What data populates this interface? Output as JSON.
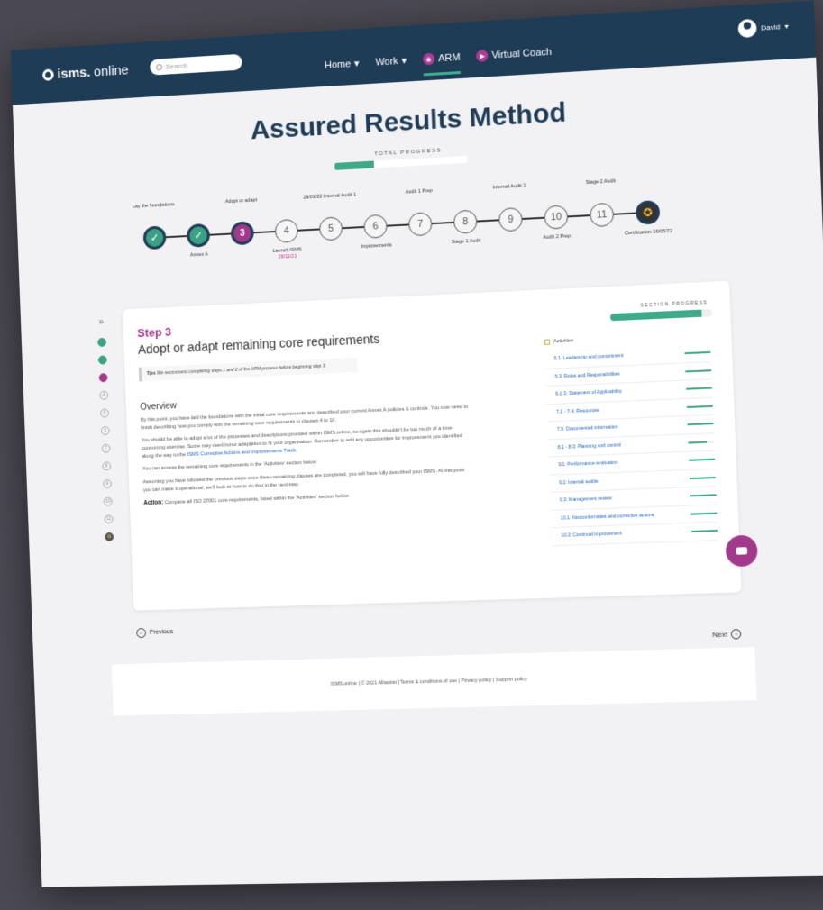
{
  "header": {
    "logo_bold": "isms.",
    "logo_thin": "online",
    "search_placeholder": "Search",
    "nav": [
      {
        "label": "Home",
        "caret": "▾"
      },
      {
        "label": "Work",
        "caret": "▾"
      },
      {
        "label": "ARM",
        "icon": "arm-icon"
      },
      {
        "label": "Virtual Coach",
        "icon": "coach-icon"
      }
    ],
    "user_name": "David",
    "user_caret": "▾"
  },
  "title": "Assured Results Method",
  "total_progress": {
    "label": "TOTAL PROGRESS",
    "value": 0.3
  },
  "stepper": {
    "steps": [
      {
        "num": "✓",
        "state": "done",
        "label_top": "Lay the foundations",
        "label_bottom": ""
      },
      {
        "num": "✓",
        "state": "done",
        "label_top": "",
        "label_bottom": "Annex A"
      },
      {
        "num": "3",
        "state": "current",
        "label_top": "Adopt or adapt",
        "label_bottom": ""
      },
      {
        "num": "4",
        "state": "todo",
        "label_top": "",
        "label_bottom": "Launch ISMS",
        "sub": "29/11/21"
      },
      {
        "num": "5",
        "state": "todo",
        "label_top": "29/01/22 Internal Audit 1",
        "label_bottom": ""
      },
      {
        "num": "6",
        "state": "todo",
        "label_top": "",
        "label_bottom": "Improvements"
      },
      {
        "num": "7",
        "state": "todo",
        "label_top": "Audit 1 Prep",
        "label_bottom": ""
      },
      {
        "num": "8",
        "state": "todo",
        "label_top": "",
        "label_bottom": "Stage 1 Audit"
      },
      {
        "num": "9",
        "state": "todo",
        "label_top": "Internal Audit 2",
        "label_bottom": ""
      },
      {
        "num": "10",
        "state": "todo",
        "label_top": "",
        "label_bottom": "Audit 2 Prep"
      },
      {
        "num": "11",
        "state": "todo",
        "label_top": "Stage 2 Audit",
        "label_bottom": ""
      },
      {
        "num": "✪",
        "state": "cert",
        "label_top": "",
        "label_bottom": "Certification 16/05/22"
      }
    ]
  },
  "sidebar": {
    "collapse": "»",
    "items": [
      {
        "state": "done",
        "glyph": ""
      },
      {
        "state": "done",
        "glyph": ""
      },
      {
        "state": "cur",
        "glyph": ""
      },
      {
        "state": "todo",
        "glyph": "4"
      },
      {
        "state": "todo",
        "glyph": "5"
      },
      {
        "state": "todo",
        "glyph": "6"
      },
      {
        "state": "todo",
        "glyph": "7"
      },
      {
        "state": "todo",
        "glyph": "8"
      },
      {
        "state": "todo",
        "glyph": "9"
      },
      {
        "state": "todo",
        "glyph": "10"
      },
      {
        "state": "todo",
        "glyph": "11"
      },
      {
        "state": "cert",
        "glyph": "✪"
      }
    ]
  },
  "step": {
    "kicker": "Step 3",
    "title": "Adopt or adapt remaining core requirements",
    "tip_label": "Tips",
    "tip_text": "We recommend completing steps 1 and 2 of the ARM process before beginning step 3.",
    "overview_heading": "Overview",
    "p1": "By this point, you have laid the foundations with the initial core requirements and described your current Annex A policies & controls. You now need to finish describing how you comply with the remaining core requirements in clauses 4 to 10.",
    "p2_pre": "You should be able to adopt a lot of the processes and descriptions provided within ISMS.online, so again this shouldn't be too much of a time-consuming exercise. Some may need minor adaptation to fit your organisation. Remember to add any opportunities for improvement you identified along the way to the ",
    "p2_link": "ISMS Corrective Actions and Improvements Track",
    "p2_post": ".",
    "p3": "You can access the remaining core requirements in the 'Activities' section below.",
    "p4": "Assuming you have followed the previous steps once these remaining clauses are completed, you will have fully described your ISMS. At this point you can make it operational, we'll look at how to do that in the next step.",
    "action_label": "Action:",
    "action_text": "Complete all ISO 27001 core requirements, listed within the 'Activities' section below."
  },
  "section_progress": {
    "label": "SECTION PROGRESS",
    "value": 0.9
  },
  "activities": {
    "heading": "Activities",
    "items": [
      {
        "label": "5.1: Leadership and commitment",
        "progress": 1.0
      },
      {
        "label": "5.3: Roles and Responsibilities",
        "progress": 1.0
      },
      {
        "label": "6.1.3: Statement of Applicability",
        "progress": 1.0
      },
      {
        "label": "7.1 - 7.4: Resources",
        "progress": 1.0
      },
      {
        "label": "7.5: Documented information",
        "progress": 1.0
      },
      {
        "label": "8.1 - 8.3: Planning and control",
        "progress": 0.7
      },
      {
        "label": "9.1: Performance evaluation",
        "progress": 1.0
      },
      {
        "label": "9.2: Internal audits",
        "progress": 1.0
      },
      {
        "label": "9.3: Management review",
        "progress": 1.0
      },
      {
        "label": "10.1: Nonconformities and corrective actions",
        "progress": 1.0
      },
      {
        "label": "10.2: Continual improvement",
        "progress": 1.0
      }
    ]
  },
  "pager": {
    "previous": "Previous",
    "next": "Next"
  },
  "footer": {
    "text": "ISMS.online | © 2021 Alliantist | Terms & conditions of use | Privacy policy | Support policy"
  },
  "colors": {
    "navy": "#1f3c57",
    "green": "#3fa98a",
    "magenta": "#a23a8c",
    "link": "#1e63b8"
  }
}
